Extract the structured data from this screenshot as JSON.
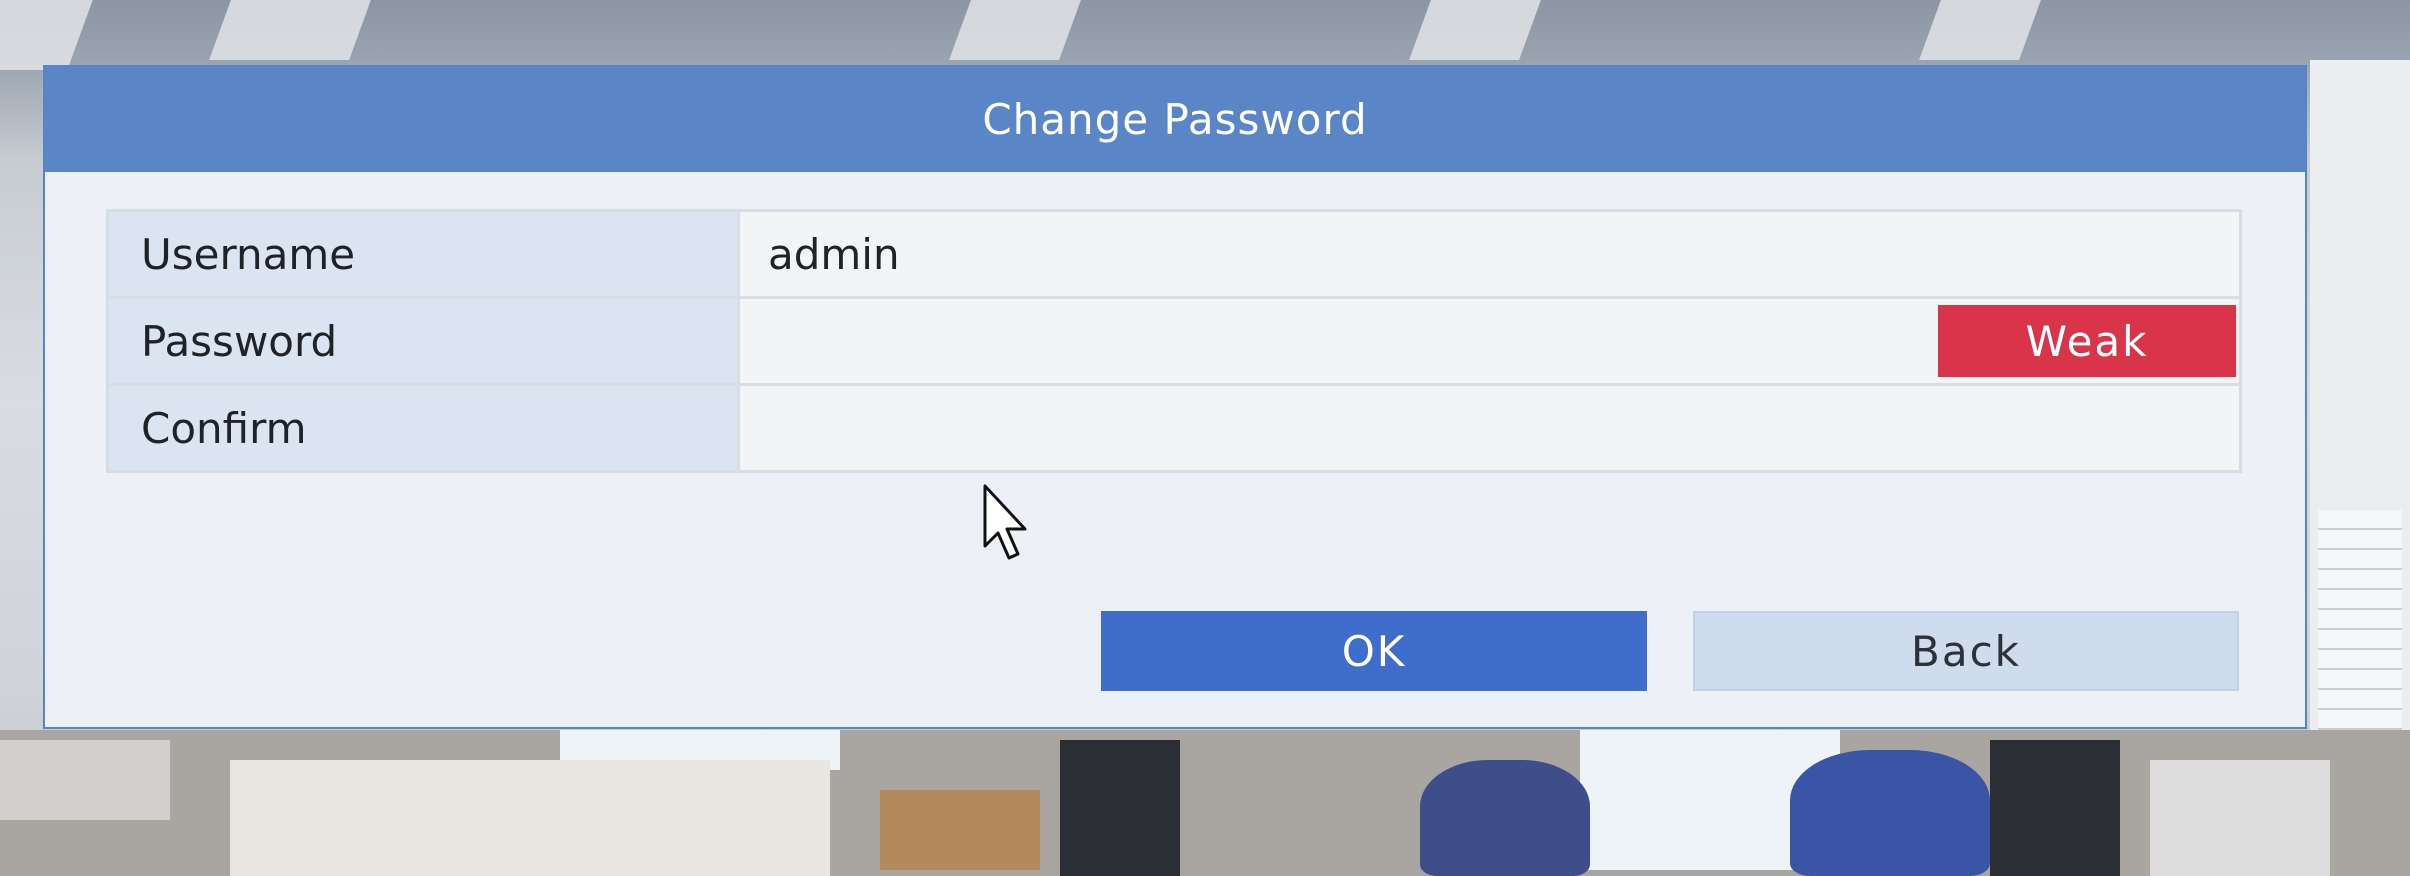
{
  "dialog": {
    "title": "Change Password",
    "fields": [
      {
        "label": "Username",
        "value": "admin",
        "placeholder": ""
      },
      {
        "label": "Password",
        "value": "",
        "strength": "Weak"
      },
      {
        "label": "Confirm",
        "value": ""
      }
    ],
    "buttons": {
      "ok_label": "OK",
      "back_label": "Back"
    }
  },
  "colors": {
    "header": "#5a86c7",
    "ok_button": "#3e6dcb",
    "back_button": "#cfdcee",
    "strength_weak": "#d9344a"
  },
  "icons": {
    "cursor": "mouse-pointer-icon"
  }
}
